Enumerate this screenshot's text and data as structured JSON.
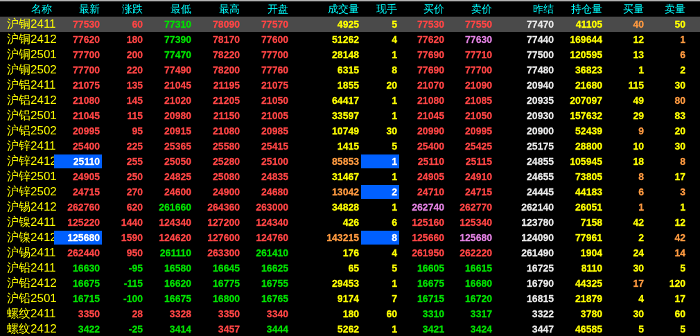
{
  "columns": [
    "名称",
    "最新",
    "涨跌",
    "最低",
    "最高",
    "开盘",
    "成交量",
    "现手",
    "买价",
    "卖价",
    "昨结",
    "持仓量",
    "买量",
    "卖量"
  ],
  "rows": [
    {
      "name": "沪铜2411",
      "selected": true,
      "cells": [
        {
          "text": "77530",
          "color": "#ff4545",
          "highlighted": false
        },
        {
          "text": "60",
          "color": "#ff4545",
          "highlighted": false
        },
        {
          "text": "77310",
          "color": "#00e000",
          "highlighted": false
        },
        {
          "text": "78090",
          "color": "#ff4545",
          "highlighted": false
        },
        {
          "text": "77570",
          "color": "#ff4545",
          "highlighted": false
        },
        {
          "text": "4925",
          "color": "#ffff00",
          "highlighted": false
        },
        {
          "text": "5",
          "color": "#ffff00",
          "highlighted": false
        },
        {
          "text": "77530",
          "color": "#ff4545",
          "highlighted": false
        },
        {
          "text": "77550",
          "color": "#ff4545",
          "highlighted": false
        },
        {
          "text": "77470",
          "color": "#e8e8e8",
          "highlighted": false
        },
        {
          "text": "41105",
          "color": "#ffff00",
          "highlighted": false
        },
        {
          "text": "40",
          "color": "#ff9a40",
          "highlighted": false
        },
        {
          "text": "50",
          "color": "#ffff00",
          "highlighted": false
        }
      ]
    },
    {
      "name": "沪铜2412",
      "selected": false,
      "cells": [
        {
          "text": "77620",
          "color": "#ff4545",
          "highlighted": false
        },
        {
          "text": "180",
          "color": "#ff4545",
          "highlighted": false
        },
        {
          "text": "77390",
          "color": "#00e000",
          "highlighted": false
        },
        {
          "text": "78170",
          "color": "#ff4545",
          "highlighted": false
        },
        {
          "text": "77600",
          "color": "#ff4545",
          "highlighted": false
        },
        {
          "text": "51262",
          "color": "#ffff00",
          "highlighted": false
        },
        {
          "text": "4",
          "color": "#ffff00",
          "highlighted": false
        },
        {
          "text": "77620",
          "color": "#ff4545",
          "highlighted": false
        },
        {
          "text": "77630",
          "color": "#e080e0",
          "highlighted": false
        },
        {
          "text": "77440",
          "color": "#e8e8e8",
          "highlighted": false
        },
        {
          "text": "169644",
          "color": "#ffff00",
          "highlighted": false
        },
        {
          "text": "12",
          "color": "#ffff00",
          "highlighted": false
        },
        {
          "text": "1",
          "color": "#ff9a40",
          "highlighted": false
        }
      ]
    },
    {
      "name": "沪铜2501",
      "selected": false,
      "cells": [
        {
          "text": "77700",
          "color": "#ff4545",
          "highlighted": false
        },
        {
          "text": "200",
          "color": "#ff4545",
          "highlighted": false
        },
        {
          "text": "77470",
          "color": "#00e000",
          "highlighted": false
        },
        {
          "text": "78220",
          "color": "#ff4545",
          "highlighted": false
        },
        {
          "text": "77700",
          "color": "#ff4545",
          "highlighted": false
        },
        {
          "text": "28148",
          "color": "#ffff00",
          "highlighted": false
        },
        {
          "text": "1",
          "color": "#ffff00",
          "highlighted": false
        },
        {
          "text": "77690",
          "color": "#ff4545",
          "highlighted": false
        },
        {
          "text": "77710",
          "color": "#ff4545",
          "highlighted": false
        },
        {
          "text": "77500",
          "color": "#e8e8e8",
          "highlighted": false
        },
        {
          "text": "120595",
          "color": "#ffff00",
          "highlighted": false
        },
        {
          "text": "13",
          "color": "#ffff00",
          "highlighted": false
        },
        {
          "text": "6",
          "color": "#ff9a40",
          "highlighted": false
        }
      ]
    },
    {
      "name": "沪铜2502",
      "selected": false,
      "cells": [
        {
          "text": "77700",
          "color": "#ff4545",
          "highlighted": false
        },
        {
          "text": "220",
          "color": "#ff4545",
          "highlighted": false
        },
        {
          "text": "77490",
          "color": "#ff4545",
          "highlighted": false
        },
        {
          "text": "78200",
          "color": "#ff4545",
          "highlighted": false
        },
        {
          "text": "77760",
          "color": "#ff4545",
          "highlighted": false
        },
        {
          "text": "6315",
          "color": "#ffff00",
          "highlighted": false
        },
        {
          "text": "8",
          "color": "#ffff00",
          "highlighted": false
        },
        {
          "text": "77690",
          "color": "#ff4545",
          "highlighted": false
        },
        {
          "text": "77700",
          "color": "#ff4545",
          "highlighted": false
        },
        {
          "text": "77480",
          "color": "#e8e8e8",
          "highlighted": false
        },
        {
          "text": "36823",
          "color": "#ffff00",
          "highlighted": false
        },
        {
          "text": "1",
          "color": "#ffff00",
          "highlighted": false
        },
        {
          "text": "2",
          "color": "#ffff00",
          "highlighted": false
        }
      ]
    },
    {
      "name": "沪铝2411",
      "selected": false,
      "cells": [
        {
          "text": "21075",
          "color": "#ff4545",
          "highlighted": false
        },
        {
          "text": "135",
          "color": "#ff4545",
          "highlighted": false
        },
        {
          "text": "21045",
          "color": "#ff4545",
          "highlighted": false
        },
        {
          "text": "21195",
          "color": "#ff4545",
          "highlighted": false
        },
        {
          "text": "21075",
          "color": "#ff4545",
          "highlighted": false
        },
        {
          "text": "1855",
          "color": "#ffff00",
          "highlighted": false
        },
        {
          "text": "20",
          "color": "#ffff00",
          "highlighted": false
        },
        {
          "text": "21070",
          "color": "#ff4545",
          "highlighted": false
        },
        {
          "text": "21090",
          "color": "#ff4545",
          "highlighted": false
        },
        {
          "text": "20940",
          "color": "#e8e8e8",
          "highlighted": false
        },
        {
          "text": "21680",
          "color": "#ffff00",
          "highlighted": false
        },
        {
          "text": "115",
          "color": "#ffff00",
          "highlighted": false
        },
        {
          "text": "30",
          "color": "#ffff00",
          "highlighted": false
        }
      ]
    },
    {
      "name": "沪铝2412",
      "selected": false,
      "cells": [
        {
          "text": "21080",
          "color": "#ff4545",
          "highlighted": false
        },
        {
          "text": "145",
          "color": "#ff4545",
          "highlighted": false
        },
        {
          "text": "21020",
          "color": "#ff4545",
          "highlighted": false
        },
        {
          "text": "21205",
          "color": "#ff4545",
          "highlighted": false
        },
        {
          "text": "21050",
          "color": "#ff4545",
          "highlighted": false
        },
        {
          "text": "64417",
          "color": "#ffff00",
          "highlighted": false
        },
        {
          "text": "1",
          "color": "#ffff00",
          "highlighted": false
        },
        {
          "text": "21080",
          "color": "#ff4545",
          "highlighted": false
        },
        {
          "text": "21085",
          "color": "#ff4545",
          "highlighted": false
        },
        {
          "text": "20935",
          "color": "#e8e8e8",
          "highlighted": false
        },
        {
          "text": "207097",
          "color": "#ffff00",
          "highlighted": false
        },
        {
          "text": "49",
          "color": "#ffff00",
          "highlighted": false
        },
        {
          "text": "80",
          "color": "#ff9a40",
          "highlighted": false
        }
      ]
    },
    {
      "name": "沪铝2501",
      "selected": false,
      "cells": [
        {
          "text": "21045",
          "color": "#ff4545",
          "highlighted": false
        },
        {
          "text": "115",
          "color": "#ff4545",
          "highlighted": false
        },
        {
          "text": "20980",
          "color": "#ff4545",
          "highlighted": false
        },
        {
          "text": "21150",
          "color": "#ff4545",
          "highlighted": false
        },
        {
          "text": "21005",
          "color": "#ff4545",
          "highlighted": false
        },
        {
          "text": "33597",
          "color": "#ffff00",
          "highlighted": false
        },
        {
          "text": "1",
          "color": "#ffff00",
          "highlighted": false
        },
        {
          "text": "21045",
          "color": "#ff4545",
          "highlighted": false
        },
        {
          "text": "21050",
          "color": "#ff4545",
          "highlighted": false
        },
        {
          "text": "20930",
          "color": "#e8e8e8",
          "highlighted": false
        },
        {
          "text": "157632",
          "color": "#ffff00",
          "highlighted": false
        },
        {
          "text": "29",
          "color": "#ffff00",
          "highlighted": false
        },
        {
          "text": "83",
          "color": "#ffff00",
          "highlighted": false
        }
      ]
    },
    {
      "name": "沪铝2502",
      "selected": false,
      "cells": [
        {
          "text": "20995",
          "color": "#ff4545",
          "highlighted": false
        },
        {
          "text": "95",
          "color": "#ff4545",
          "highlighted": false
        },
        {
          "text": "20915",
          "color": "#ff4545",
          "highlighted": false
        },
        {
          "text": "21080",
          "color": "#ff4545",
          "highlighted": false
        },
        {
          "text": "20985",
          "color": "#ff4545",
          "highlighted": false
        },
        {
          "text": "10749",
          "color": "#ffff00",
          "highlighted": false
        },
        {
          "text": "30",
          "color": "#ffff00",
          "highlighted": false
        },
        {
          "text": "20990",
          "color": "#ff4545",
          "highlighted": false
        },
        {
          "text": "20995",
          "color": "#ff4545",
          "highlighted": false
        },
        {
          "text": "20900",
          "color": "#e8e8e8",
          "highlighted": false
        },
        {
          "text": "52439",
          "color": "#ffff00",
          "highlighted": false
        },
        {
          "text": "9",
          "color": "#ff9a40",
          "highlighted": false
        },
        {
          "text": "20",
          "color": "#ffff00",
          "highlighted": false
        }
      ]
    },
    {
      "name": "沪锌2411",
      "selected": false,
      "cells": [
        {
          "text": "25400",
          "color": "#ff4545",
          "highlighted": false
        },
        {
          "text": "225",
          "color": "#ff4545",
          "highlighted": false
        },
        {
          "text": "25365",
          "color": "#ff4545",
          "highlighted": false
        },
        {
          "text": "25580",
          "color": "#ff4545",
          "highlighted": false
        },
        {
          "text": "25415",
          "color": "#ff4545",
          "highlighted": false
        },
        {
          "text": "1415",
          "color": "#ffff00",
          "highlighted": false
        },
        {
          "text": "5",
          "color": "#ffff00",
          "highlighted": false
        },
        {
          "text": "25400",
          "color": "#ff4545",
          "highlighted": false
        },
        {
          "text": "25425",
          "color": "#ff4545",
          "highlighted": false
        },
        {
          "text": "25175",
          "color": "#e8e8e8",
          "highlighted": false
        },
        {
          "text": "28800",
          "color": "#ffff00",
          "highlighted": false
        },
        {
          "text": "10",
          "color": "#ffff00",
          "highlighted": false
        },
        {
          "text": "30",
          "color": "#ffff00",
          "highlighted": false
        }
      ]
    },
    {
      "name": "沪锌2412",
      "selected": false,
      "cells": [
        {
          "text": "25110",
          "color": "#ffffff",
          "highlighted": true
        },
        {
          "text": "255",
          "color": "#ff4545",
          "highlighted": false
        },
        {
          "text": "25050",
          "color": "#ff4545",
          "highlighted": false
        },
        {
          "text": "25280",
          "color": "#ff4545",
          "highlighted": false
        },
        {
          "text": "25100",
          "color": "#ff4545",
          "highlighted": false
        },
        {
          "text": "85853",
          "color": "#ff9a40",
          "highlighted": false
        },
        {
          "text": "1",
          "color": "#ffffff",
          "highlighted": true
        },
        {
          "text": "25110",
          "color": "#ff4545",
          "highlighted": false
        },
        {
          "text": "25115",
          "color": "#ff4545",
          "highlighted": false
        },
        {
          "text": "24855",
          "color": "#e8e8e8",
          "highlighted": false
        },
        {
          "text": "105945",
          "color": "#ffff00",
          "highlighted": false
        },
        {
          "text": "18",
          "color": "#ffff00",
          "highlighted": false
        },
        {
          "text": "8",
          "color": "#ff9a40",
          "highlighted": false
        }
      ]
    },
    {
      "name": "沪锌2501",
      "selected": false,
      "cells": [
        {
          "text": "24905",
          "color": "#ff4545",
          "highlighted": false
        },
        {
          "text": "250",
          "color": "#ff4545",
          "highlighted": false
        },
        {
          "text": "24825",
          "color": "#ff4545",
          "highlighted": false
        },
        {
          "text": "25080",
          "color": "#ff4545",
          "highlighted": false
        },
        {
          "text": "24835",
          "color": "#ff4545",
          "highlighted": false
        },
        {
          "text": "31467",
          "color": "#ffff00",
          "highlighted": false
        },
        {
          "text": "1",
          "color": "#ffff00",
          "highlighted": false
        },
        {
          "text": "24905",
          "color": "#ff4545",
          "highlighted": false
        },
        {
          "text": "24910",
          "color": "#ff4545",
          "highlighted": false
        },
        {
          "text": "24655",
          "color": "#e8e8e8",
          "highlighted": false
        },
        {
          "text": "73805",
          "color": "#ffff00",
          "highlighted": false
        },
        {
          "text": "8",
          "color": "#ff9a40",
          "highlighted": false
        },
        {
          "text": "17",
          "color": "#ffff00",
          "highlighted": false
        }
      ]
    },
    {
      "name": "沪锌2502",
      "selected": false,
      "cells": [
        {
          "text": "24715",
          "color": "#ff4545",
          "highlighted": false
        },
        {
          "text": "270",
          "color": "#ff4545",
          "highlighted": false
        },
        {
          "text": "24600",
          "color": "#ff4545",
          "highlighted": false
        },
        {
          "text": "24900",
          "color": "#ff4545",
          "highlighted": false
        },
        {
          "text": "24680",
          "color": "#ff4545",
          "highlighted": false
        },
        {
          "text": "13042",
          "color": "#ff9a40",
          "highlighted": false
        },
        {
          "text": "2",
          "color": "#ffffff",
          "highlighted": true
        },
        {
          "text": "24710",
          "color": "#ff4545",
          "highlighted": false
        },
        {
          "text": "24715",
          "color": "#ff4545",
          "highlighted": false
        },
        {
          "text": "24445",
          "color": "#e8e8e8",
          "highlighted": false
        },
        {
          "text": "44183",
          "color": "#ffff00",
          "highlighted": false
        },
        {
          "text": "6",
          "color": "#ff9a40",
          "highlighted": false
        },
        {
          "text": "3",
          "color": "#ff9a40",
          "highlighted": false
        }
      ]
    },
    {
      "name": "沪锡2412",
      "selected": false,
      "cells": [
        {
          "text": "262760",
          "color": "#ff4545",
          "highlighted": false
        },
        {
          "text": "620",
          "color": "#ff4545",
          "highlighted": false
        },
        {
          "text": "261660",
          "color": "#00e000",
          "highlighted": false
        },
        {
          "text": "264360",
          "color": "#ff4545",
          "highlighted": false
        },
        {
          "text": "263000",
          "color": "#ff4545",
          "highlighted": false
        },
        {
          "text": "34828",
          "color": "#ffff00",
          "highlighted": false
        },
        {
          "text": "1",
          "color": "#ffff00",
          "highlighted": false
        },
        {
          "text": "262740",
          "color": "#e080e0",
          "highlighted": false
        },
        {
          "text": "262770",
          "color": "#ff4545",
          "highlighted": false
        },
        {
          "text": "262140",
          "color": "#e8e8e8",
          "highlighted": false
        },
        {
          "text": "26051",
          "color": "#ffff00",
          "highlighted": false
        },
        {
          "text": "1",
          "color": "#ff9a40",
          "highlighted": false
        },
        {
          "text": "1",
          "color": "#ffff00",
          "highlighted": false
        }
      ]
    },
    {
      "name": "沪镍2411",
      "selected": false,
      "cells": [
        {
          "text": "125220",
          "color": "#ff4545",
          "highlighted": false
        },
        {
          "text": "1440",
          "color": "#ff4545",
          "highlighted": false
        },
        {
          "text": "124340",
          "color": "#ff4545",
          "highlighted": false
        },
        {
          "text": "127200",
          "color": "#ff4545",
          "highlighted": false
        },
        {
          "text": "124340",
          "color": "#ff4545",
          "highlighted": false
        },
        {
          "text": "426",
          "color": "#ffff00",
          "highlighted": false
        },
        {
          "text": "6",
          "color": "#ffff00",
          "highlighted": false
        },
        {
          "text": "125160",
          "color": "#ff4545",
          "highlighted": false
        },
        {
          "text": "125340",
          "color": "#ff4545",
          "highlighted": false
        },
        {
          "text": "123780",
          "color": "#e8e8e8",
          "highlighted": false
        },
        {
          "text": "7158",
          "color": "#ffff00",
          "highlighted": false
        },
        {
          "text": "42",
          "color": "#ffff00",
          "highlighted": false
        },
        {
          "text": "12",
          "color": "#ffff00",
          "highlighted": false
        }
      ]
    },
    {
      "name": "沪镍2412",
      "selected": false,
      "cells": [
        {
          "text": "125680",
          "color": "#ffffff",
          "highlighted": true
        },
        {
          "text": "1590",
          "color": "#ff4545",
          "highlighted": false
        },
        {
          "text": "124620",
          "color": "#ff4545",
          "highlighted": false
        },
        {
          "text": "127600",
          "color": "#ff4545",
          "highlighted": false
        },
        {
          "text": "124760",
          "color": "#ff4545",
          "highlighted": false
        },
        {
          "text": "143215",
          "color": "#ff9a40",
          "highlighted": false
        },
        {
          "text": "8",
          "color": "#ffffff",
          "highlighted": true
        },
        {
          "text": "125660",
          "color": "#ff4545",
          "highlighted": false
        },
        {
          "text": "125680",
          "color": "#e080e0",
          "highlighted": false
        },
        {
          "text": "124090",
          "color": "#e8e8e8",
          "highlighted": false
        },
        {
          "text": "77961",
          "color": "#ffff00",
          "highlighted": false
        },
        {
          "text": "2",
          "color": "#ffff00",
          "highlighted": false
        },
        {
          "text": "42",
          "color": "#ff9a40",
          "highlighted": false
        }
      ]
    },
    {
      "name": "沪锡2411",
      "selected": false,
      "cells": [
        {
          "text": "262440",
          "color": "#ff4545",
          "highlighted": false
        },
        {
          "text": "950",
          "color": "#ff4545",
          "highlighted": false
        },
        {
          "text": "261110",
          "color": "#00e000",
          "highlighted": false
        },
        {
          "text": "263300",
          "color": "#ff4545",
          "highlighted": false
        },
        {
          "text": "261410",
          "color": "#00e000",
          "highlighted": false
        },
        {
          "text": "176",
          "color": "#ffff00",
          "highlighted": false
        },
        {
          "text": "4",
          "color": "#ffff00",
          "highlighted": false
        },
        {
          "text": "261950",
          "color": "#ff4545",
          "highlighted": false
        },
        {
          "text": "262220",
          "color": "#ff4545",
          "highlighted": false
        },
        {
          "text": "261490",
          "color": "#e8e8e8",
          "highlighted": false
        },
        {
          "text": "1904",
          "color": "#ffff00",
          "highlighted": false
        },
        {
          "text": "24",
          "color": "#ffff00",
          "highlighted": false
        },
        {
          "text": "14",
          "color": "#ff9a40",
          "highlighted": false
        }
      ]
    },
    {
      "name": "沪铅2411",
      "selected": false,
      "cells": [
        {
          "text": "16630",
          "color": "#00e000",
          "highlighted": false
        },
        {
          "text": "-95",
          "color": "#00e000",
          "highlighted": false
        },
        {
          "text": "16580",
          "color": "#00e000",
          "highlighted": false
        },
        {
          "text": "16645",
          "color": "#00e000",
          "highlighted": false
        },
        {
          "text": "16625",
          "color": "#00e000",
          "highlighted": false
        },
        {
          "text": "65",
          "color": "#ffff00",
          "highlighted": false
        },
        {
          "text": "5",
          "color": "#ffff00",
          "highlighted": false
        },
        {
          "text": "16605",
          "color": "#00e000",
          "highlighted": false
        },
        {
          "text": "16615",
          "color": "#00e000",
          "highlighted": false
        },
        {
          "text": "16725",
          "color": "#e8e8e8",
          "highlighted": false
        },
        {
          "text": "8110",
          "color": "#ffff00",
          "highlighted": false
        },
        {
          "text": "30",
          "color": "#ffff00",
          "highlighted": false
        },
        {
          "text": "5",
          "color": "#ffff00",
          "highlighted": false
        }
      ]
    },
    {
      "name": "沪铅2412",
      "selected": false,
      "cells": [
        {
          "text": "16675",
          "color": "#00e000",
          "highlighted": false
        },
        {
          "text": "-115",
          "color": "#00e000",
          "highlighted": false
        },
        {
          "text": "16620",
          "color": "#00e000",
          "highlighted": false
        },
        {
          "text": "16775",
          "color": "#00e000",
          "highlighted": false
        },
        {
          "text": "16755",
          "color": "#00e000",
          "highlighted": false
        },
        {
          "text": "29453",
          "color": "#ffff00",
          "highlighted": false
        },
        {
          "text": "1",
          "color": "#ffff00",
          "highlighted": false
        },
        {
          "text": "16675",
          "color": "#00e000",
          "highlighted": false
        },
        {
          "text": "16680",
          "color": "#00e000",
          "highlighted": false
        },
        {
          "text": "16790",
          "color": "#e8e8e8",
          "highlighted": false
        },
        {
          "text": "44325",
          "color": "#ffff00",
          "highlighted": false
        },
        {
          "text": "17",
          "color": "#ff9a40",
          "highlighted": false
        },
        {
          "text": "120",
          "color": "#ffff00",
          "highlighted": false
        }
      ]
    },
    {
      "name": "沪铅2501",
      "selected": false,
      "cells": [
        {
          "text": "16715",
          "color": "#00e000",
          "highlighted": false
        },
        {
          "text": "-100",
          "color": "#00e000",
          "highlighted": false
        },
        {
          "text": "16675",
          "color": "#00e000",
          "highlighted": false
        },
        {
          "text": "16800",
          "color": "#00e000",
          "highlighted": false
        },
        {
          "text": "16765",
          "color": "#00e000",
          "highlighted": false
        },
        {
          "text": "9174",
          "color": "#ffff00",
          "highlighted": false
        },
        {
          "text": "7",
          "color": "#ffff00",
          "highlighted": false
        },
        {
          "text": "16715",
          "color": "#00e000",
          "highlighted": false
        },
        {
          "text": "16720",
          "color": "#00e000",
          "highlighted": false
        },
        {
          "text": "16815",
          "color": "#e8e8e8",
          "highlighted": false
        },
        {
          "text": "21879",
          "color": "#ffff00",
          "highlighted": false
        },
        {
          "text": "4",
          "color": "#ffff00",
          "highlighted": false
        },
        {
          "text": "17",
          "color": "#ffff00",
          "highlighted": false
        }
      ]
    },
    {
      "name": "螺纹2411",
      "selected": false,
      "cells": [
        {
          "text": "3350",
          "color": "#ff4545",
          "highlighted": false
        },
        {
          "text": "28",
          "color": "#ff4545",
          "highlighted": false
        },
        {
          "text": "3328",
          "color": "#ff4545",
          "highlighted": false
        },
        {
          "text": "3350",
          "color": "#ff4545",
          "highlighted": false
        },
        {
          "text": "3340",
          "color": "#ff4545",
          "highlighted": false
        },
        {
          "text": "180",
          "color": "#ffff00",
          "highlighted": false
        },
        {
          "text": "60",
          "color": "#ffff00",
          "highlighted": false
        },
        {
          "text": "3310",
          "color": "#00e000",
          "highlighted": false
        },
        {
          "text": "3317",
          "color": "#00e000",
          "highlighted": false
        },
        {
          "text": "3322",
          "color": "#e8e8e8",
          "highlighted": false
        },
        {
          "text": "3780",
          "color": "#ffff00",
          "highlighted": false
        },
        {
          "text": "30",
          "color": "#ffff00",
          "highlighted": false
        },
        {
          "text": "60",
          "color": "#ffff00",
          "highlighted": false
        }
      ]
    },
    {
      "name": "螺纹2412",
      "selected": false,
      "cells": [
        {
          "text": "3422",
          "color": "#00e000",
          "highlighted": false
        },
        {
          "text": "-25",
          "color": "#00e000",
          "highlighted": false
        },
        {
          "text": "3414",
          "color": "#00e000",
          "highlighted": false
        },
        {
          "text": "3457",
          "color": "#ff4545",
          "highlighted": false
        },
        {
          "text": "3444",
          "color": "#00e000",
          "highlighted": false
        },
        {
          "text": "5262",
          "color": "#ffff00",
          "highlighted": false
        },
        {
          "text": "1",
          "color": "#ffff00",
          "highlighted": false
        },
        {
          "text": "3421",
          "color": "#00e000",
          "highlighted": false
        },
        {
          "text": "3424",
          "color": "#00e000",
          "highlighted": false
        },
        {
          "text": "3447",
          "color": "#e8e8e8",
          "highlighted": false
        },
        {
          "text": "46585",
          "color": "#ffff00",
          "highlighted": false
        },
        {
          "text": "5",
          "color": "#ffff00",
          "highlighted": false
        },
        {
          "text": "5",
          "color": "#ffff00",
          "highlighted": false
        }
      ]
    }
  ]
}
